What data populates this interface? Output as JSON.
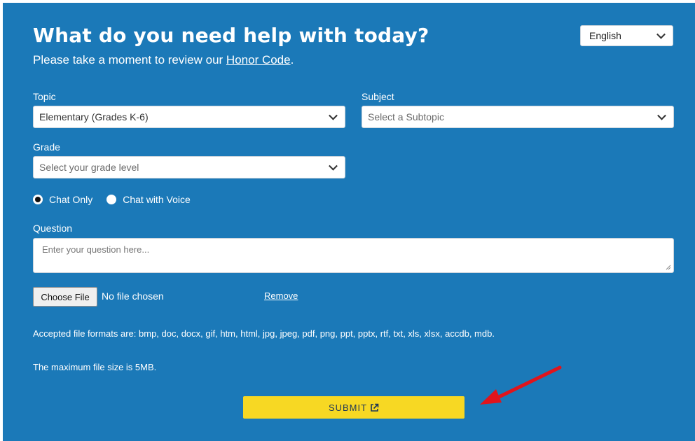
{
  "header": {
    "title": "What do you need help with today?",
    "subtitle_prefix": "Please take a moment to review our ",
    "honor_code_link": "Honor Code",
    "subtitle_suffix": "."
  },
  "language_select": {
    "value": "English"
  },
  "form": {
    "topic_label": "Topic",
    "topic_value": "Elementary (Grades K-6)",
    "subject_label": "Subject",
    "subject_placeholder": "Select a Subtopic",
    "grade_label": "Grade",
    "grade_placeholder": "Select your grade level",
    "chat_only_label": "Chat Only",
    "chat_voice_label": "Chat with Voice",
    "chat_mode_selected": "Chat Only",
    "question_label": "Question",
    "question_placeholder": "Enter your question here...",
    "choose_file_label": "Choose File",
    "file_status": "No file chosen",
    "remove_label": "Remove",
    "accepted_formats": "Accepted file formats are: bmp, doc, docx, gif, htm, html, jpg, jpeg, pdf, png, ppt, pptx, rtf, txt, xls, xlsx, accdb, mdb.",
    "max_size": "The maximum file size is 5MB.",
    "submit_label": "SUBMIT"
  },
  "colors": {
    "panel_bg": "#1b79b8",
    "submit_bg": "#f7d823",
    "arrow": "#e0141c"
  },
  "icons": {
    "submit": "external-link-icon",
    "dropdown": "chevron-down-icon",
    "annotation": "red-arrow"
  }
}
